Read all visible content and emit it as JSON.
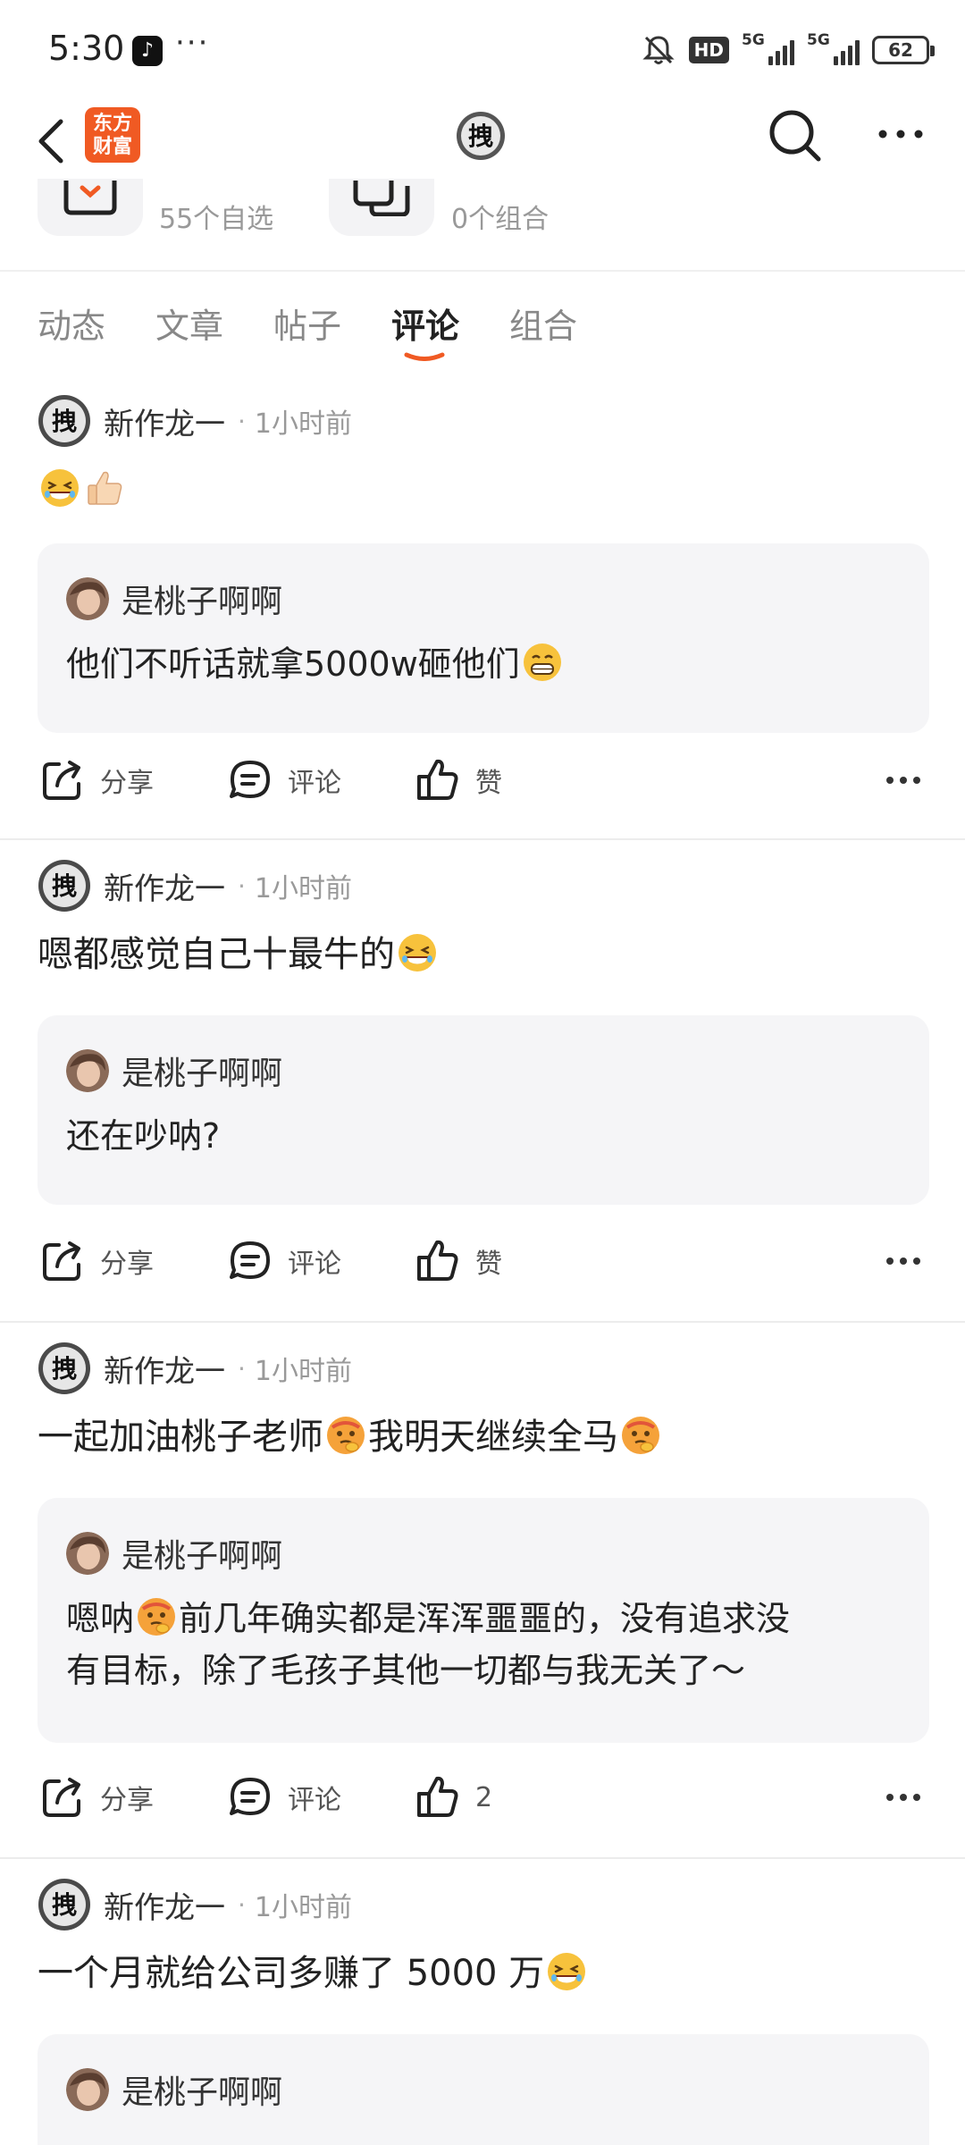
{
  "status_bar": {
    "time": "5:30",
    "tiktok_glyph": "♪",
    "dots": "···",
    "hd_label": "HD",
    "signal_labels": [
      "5G",
      "5G"
    ],
    "battery": "62"
  },
  "nav": {
    "logo_line1": "东方",
    "logo_line2": "财富",
    "avatar_char": "拽"
  },
  "stats": {
    "watchlist": "55个自选",
    "portfolio": "0个组合"
  },
  "tabs": [
    "动态",
    "文章",
    "帖子",
    "评论",
    "组合"
  ],
  "active_tab": "评论",
  "colors": {
    "accent": "#f05a23",
    "quote_bg": "#f5f5f7"
  },
  "posts": [
    {
      "author": "新作龙一",
      "time": "1小时前",
      "text_parts": [
        "",
        ""
      ],
      "emojis": [
        "laughing-face",
        "thumbs-up"
      ],
      "quote_author": "是桃子啊啊",
      "quote_text_line1": "他们不听话就拿5000w砸他们",
      "quote_text_line2": "",
      "quote_emoji": "grinning-face",
      "share": "分享",
      "comment": "评论",
      "like": "赞"
    },
    {
      "author": "新作龙一",
      "time": "1小时前",
      "text": "嗯都感觉自己十最牛的",
      "emoji": "laughing-face",
      "quote_author": "是桃子啊啊",
      "quote_text_line1": "还在吵呐?",
      "share": "分享",
      "comment": "评论",
      "like": "赞"
    },
    {
      "author": "新作龙一",
      "time": "1小时前",
      "text_a": "一起加油桃子老师",
      "text_b": "我明天继续全马",
      "emoji": "thinking-face",
      "quote_author": "是桃子啊啊",
      "quote_text_a": "嗯呐",
      "quote_text_b": "前几年确实都是浑浑噩噩的，没有追求没",
      "quote_text_line2": "有目标，除了毛孩子其他一切都与我无关了～",
      "share": "分享",
      "comment": "评论",
      "like": "2"
    },
    {
      "author": "新作龙一",
      "time": "1小时前",
      "text": "一个月就给公司多赚了 5000 万",
      "emoji": "laughing-face",
      "quote_author": "是桃子啊啊"
    }
  ]
}
